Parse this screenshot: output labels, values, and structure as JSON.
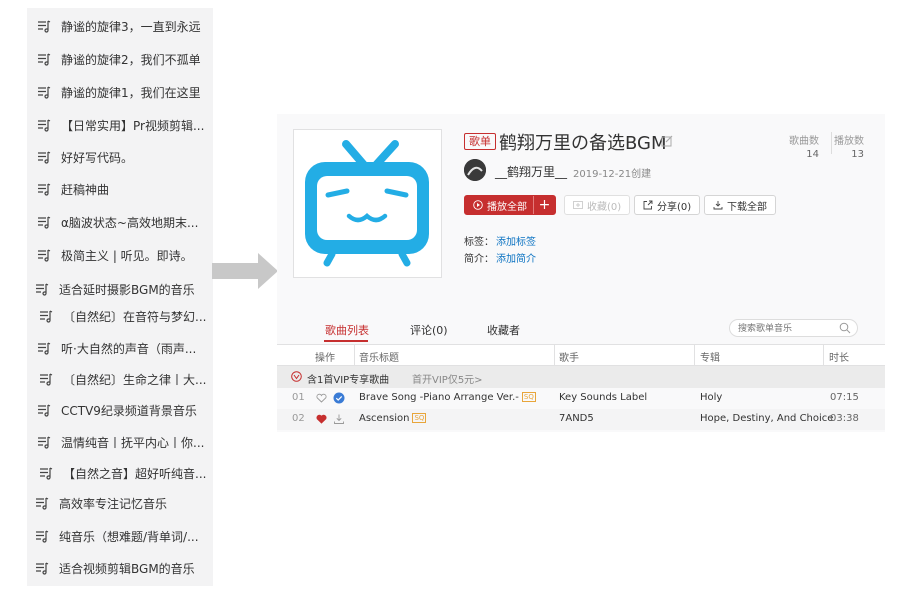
{
  "left_list": {
    "items": [
      "静谧的旋律3，一直到永远",
      "静谧的旋律2，我们不孤单",
      "静谧的旋律1，我们在这里",
      "【日常实用】Pr视频剪辑...",
      "好好写代码。",
      "赶稿神曲",
      "α脑波状态~高效地期末...",
      "极简主义 | 听见。即诗。",
      "适合延时摄影BGM的音乐",
      "〔自然纪〕在音符与梦幻...",
      "听·大自然的声音（雨声...",
      "〔自然纪〕生命之律丨大...",
      "CCTV9纪录频道背景音乐",
      "温情纯音丨抚平内心丨你...",
      "【自然之音】超好听纯音...",
      "高效率专注记忆音乐",
      "纯音乐（想难题/背单词/...",
      "适合视频剪辑BGM的音乐"
    ]
  },
  "playlist": {
    "badge": "歌单",
    "title": "鹤翔万里の备选BGM",
    "stats": {
      "songs_label": "歌曲数",
      "songs_value": "14",
      "plays_label": "播放数",
      "plays_value": "13"
    },
    "creator": "__鹤翔万里__",
    "created": "2019-12-21创建",
    "buttons": {
      "play_all": "播放全部",
      "add": "+",
      "collect": "收藏(0)",
      "share": "分享(0)",
      "download": "下载全部"
    },
    "tags_label": "标签：",
    "tags_link": "添加标签",
    "intro_label": "简介：",
    "intro_link": "添加简介"
  },
  "tabs": [
    "歌曲列表",
    "评论(0)",
    "收藏者"
  ],
  "search": {
    "placeholder": "搜索歌单音乐"
  },
  "table": {
    "headers": [
      "操作",
      "音乐标题",
      "歌手",
      "专辑",
      "时长"
    ],
    "vip_label": "含1首VIP专享歌曲",
    "vip_link": "首开VIP仅5元>",
    "rows": [
      {
        "num": "01",
        "title": "Brave Song -Piano Arrange Ver.-",
        "quality": "SQ",
        "liked": false,
        "artist": "Key Sounds Label",
        "album": "Holy",
        "duration": "07:15"
      },
      {
        "num": "02",
        "title": "Ascension",
        "quality": "SQ",
        "liked": true,
        "artist": "7AND5",
        "album": "Hope, Destiny, And Choice",
        "duration": "03:38"
      }
    ]
  },
  "colors": {
    "accent": "#c62f2f",
    "link": "#0c73c2",
    "cover": "#23ade5"
  }
}
